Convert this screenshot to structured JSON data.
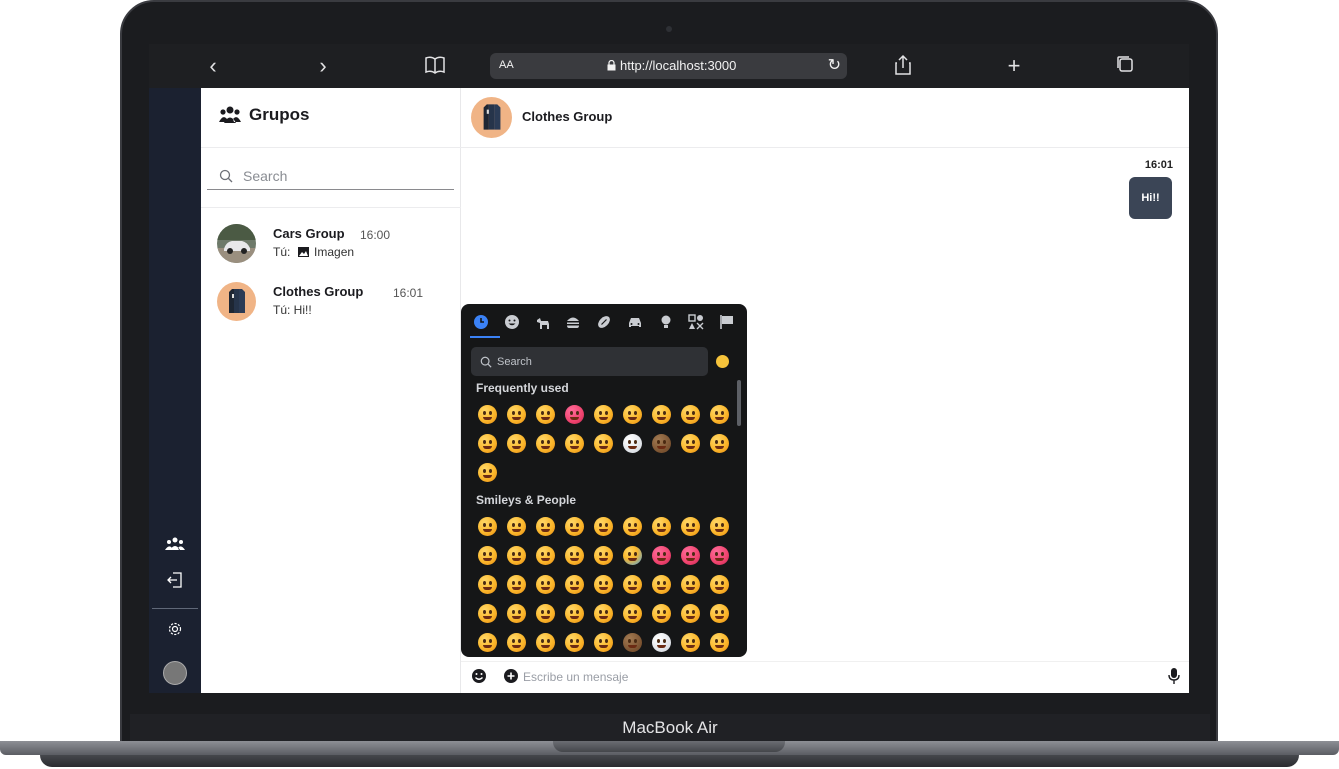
{
  "device": {
    "label": "MacBook Air"
  },
  "browser": {
    "text_size_label": "AA",
    "url": "http://localhost:3000",
    "icons": [
      "back-icon",
      "forward-icon",
      "bookmarks-icon",
      "share-icon",
      "new-tab-icon",
      "tabs-icon",
      "reload-icon",
      "lock-icon"
    ]
  },
  "groups_panel": {
    "title": "Grupos",
    "search_placeholder": "Search",
    "items": [
      {
        "name": "Cars Group",
        "time": "16:00",
        "last_prefix": "Tú:",
        "last_text": "Imagen"
      },
      {
        "name": "Clothes Group",
        "time": "16:01",
        "last_prefix": "Tú: Hi!!",
        "last_text": ""
      }
    ]
  },
  "chat": {
    "title": "Clothes Group",
    "message_time": "16:01",
    "message_text": "Hi!!",
    "composer_placeholder": "Escribe un mensaje"
  },
  "emoji_picker": {
    "search_placeholder": "Search",
    "categories": [
      "recent",
      "smileys",
      "animals",
      "food",
      "activities",
      "travel",
      "objects",
      "symbols",
      "flags"
    ],
    "section_frequent": "Frequently used",
    "section_smileys": "Smileys & People"
  },
  "colors": {
    "accent": "#3b82f6",
    "bubble": "#3b4556",
    "rail": "#1b2130",
    "picker_bg": "#151617"
  }
}
